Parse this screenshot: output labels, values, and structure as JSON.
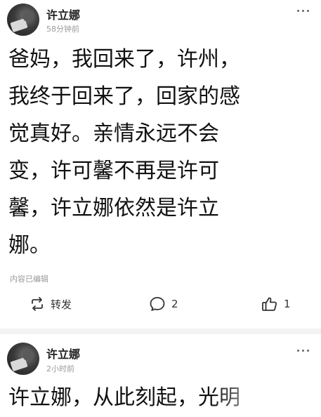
{
  "posts": [
    {
      "user": "许立娜",
      "time": "58分钟前",
      "lines": [
        "爸妈，我回来了，许州，",
        "我终于回来了，回家的感",
        "觉真好。亲情永远不会",
        "变，许可馨不再是许可",
        "馨，许立娜依然是许立",
        "娜。"
      ],
      "edited_note": "内容已编辑",
      "actions": {
        "repost_label": "转发",
        "comment_count": "2",
        "like_count": "1"
      }
    },
    {
      "user": "许立娜",
      "time": "2小时前",
      "lines": [
        "许立娜，从此刻起，光明"
      ]
    }
  ],
  "icons": {
    "more": "more-horizontal-icon",
    "repost": "repost-icon",
    "comment": "comment-icon",
    "like": "thumbs-up-icon"
  }
}
